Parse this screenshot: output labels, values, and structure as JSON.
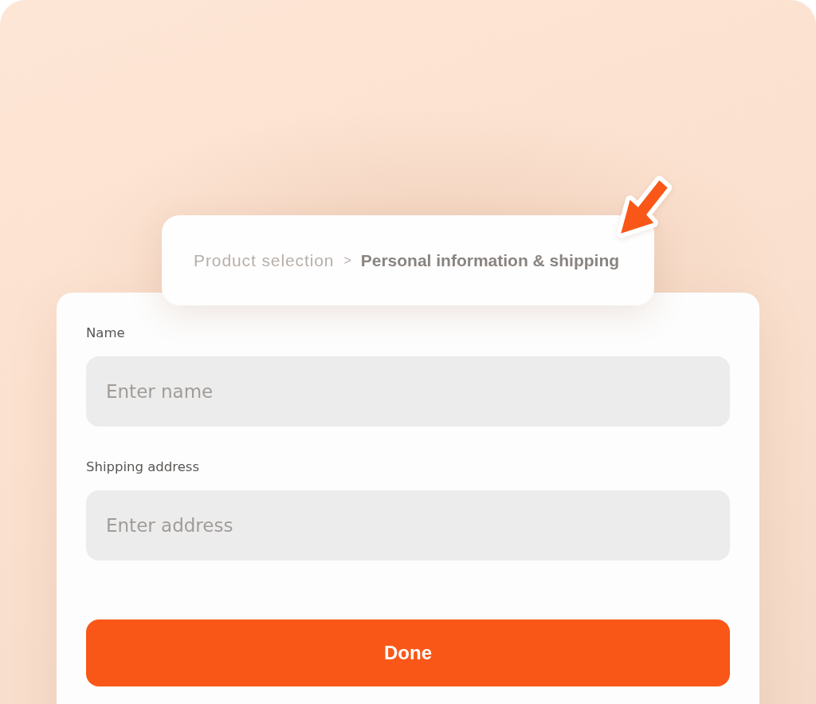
{
  "breadcrumb": {
    "items": [
      {
        "label": "Product selection",
        "selected": false
      },
      {
        "label": "Personal information & shipping",
        "selected": true
      }
    ],
    "separator": ">"
  },
  "form": {
    "fields": [
      {
        "label": "Name",
        "placeholder": "Enter name"
      },
      {
        "label": "Shipping address",
        "placeholder": "Enter address"
      }
    ],
    "submit": {
      "label": "Done"
    }
  }
}
